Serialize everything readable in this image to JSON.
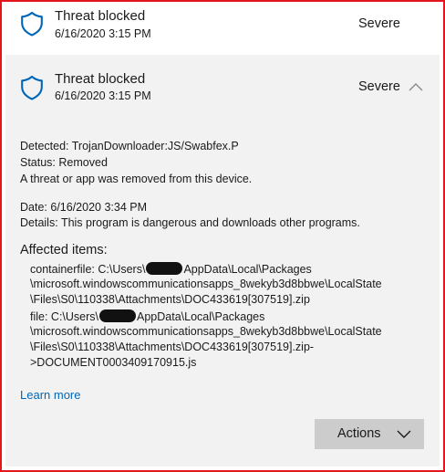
{
  "items": [
    {
      "title": "Threat blocked",
      "datetime": "6/16/2020 3:15 PM",
      "severity": "Severe",
      "icon": "shield-icon"
    },
    {
      "title": "Threat blocked",
      "datetime": "6/16/2020 3:15 PM",
      "severity": "Severe",
      "icon": "shield-icon",
      "expanded": true,
      "details": {
        "detected_label": "Detected:",
        "detected_value": "TrojanDownloader:JS/Swabfex.P",
        "status_label": "Status:",
        "status_value": "Removed",
        "status_note": "A threat or app was removed from this device.",
        "date_label": "Date:",
        "date_value": "6/16/2020 3:34 PM",
        "details_label": "Details:",
        "details_value": "This program is dangerous and downloads other programs.",
        "affected_heading": "Affected items:",
        "affected": [
          {
            "line1_prefix": "containerfile: C:\\Users\\",
            "line1_suffix": "AppData\\Local\\Packages",
            "line2": "\\microsoft.windowscommunicationsapps_8wekyb3d8bbwe\\LocalState",
            "line3": "\\Files\\S0\\110338\\Attachments\\DOC433619[307519].zip"
          },
          {
            "line1_prefix": "file: C:\\Users\\",
            "line1_suffix": "AppData\\Local\\Packages",
            "line2": "\\microsoft.windowscommunicationsapps_8wekyb3d8bbwe\\LocalState",
            "line3": "\\Files\\S0\\110338\\Attachments\\DOC433619[307519].zip-",
            "line4": ">DOCUMENT0003409170915.js"
          }
        ],
        "learn_more": "Learn more",
        "actions_label": "Actions"
      }
    }
  ],
  "colors": {
    "accent_blue": "#0067b8",
    "expanded_bg": "#f2f2f2",
    "button_bg": "#cccccc",
    "frame_border": "#e4161b"
  }
}
